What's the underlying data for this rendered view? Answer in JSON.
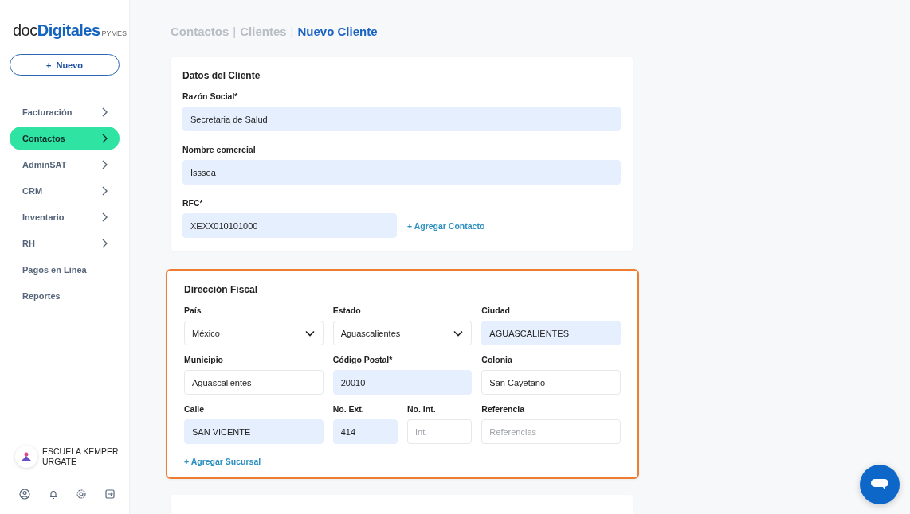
{
  "logo": {
    "prefix": "doc",
    "brand": "Digitales",
    "suffix": "PYMES"
  },
  "new_button": {
    "icon": "+",
    "label": "Nuevo"
  },
  "sidebar": {
    "items": [
      {
        "label": "Facturación",
        "selected": false,
        "has_submenu": true
      },
      {
        "label": "Contactos",
        "selected": true,
        "has_submenu": true
      },
      {
        "label": "AdminSAT",
        "selected": false,
        "has_submenu": true
      },
      {
        "label": "CRM",
        "selected": false,
        "has_submenu": true
      },
      {
        "label": "Inventario",
        "selected": false,
        "has_submenu": true
      },
      {
        "label": "RH",
        "selected": false,
        "has_submenu": true
      },
      {
        "label": "Pagos en Línea",
        "selected": false,
        "has_submenu": false
      },
      {
        "label": "Reportes",
        "selected": false,
        "has_submenu": false
      }
    ]
  },
  "account": {
    "name": "ESCUELA KEMPER URGATE"
  },
  "breadcrumb": [
    {
      "label": "Contactos",
      "current": false
    },
    {
      "label": "Clientes",
      "current": false
    },
    {
      "label": "Nuevo Cliente",
      "current": true
    }
  ],
  "breadcrumb_separator": "|",
  "client_card": {
    "title": "Datos del Cliente",
    "fields": [
      {
        "label": "Razón Social*",
        "value": "Secretaria de Salud",
        "autofilled": true
      },
      {
        "label": "Nombre comercial",
        "value": "Isssea",
        "autofilled": true
      },
      {
        "label": "RFC*",
        "value": "XEXX010101000",
        "autofilled": true
      }
    ],
    "link": "+ Agregar Contacto"
  },
  "address_card": {
    "title": "Dirección Fiscal",
    "highlighted": true,
    "fields": [
      {
        "label": "País",
        "kind": "select",
        "value": "México",
        "autofilled": false
      },
      {
        "label": "Estado",
        "kind": "select",
        "value": "Aguascalientes",
        "autofilled": false
      },
      {
        "label": "Ciudad",
        "kind": "input",
        "value": "AGUASCALIENTES",
        "autofilled": true
      },
      {
        "label": "Municipio",
        "kind": "input",
        "value": "Aguascalientes",
        "autofilled": false
      },
      {
        "label": "Código Postal*",
        "kind": "input",
        "value": "20010",
        "autofilled": true
      },
      {
        "label": "Colonia",
        "kind": "input",
        "value": "San Cayetano",
        "autofilled": false
      },
      {
        "label": "Calle",
        "kind": "input",
        "value": "SAN VICENTE",
        "autofilled": true
      },
      {
        "label": "No. Ext.",
        "kind": "input",
        "value": "414",
        "autofilled": true
      },
      {
        "label": "No. Int.",
        "kind": "input",
        "placeholder": "Int.",
        "autofilled": false
      },
      {
        "label": "Referencia",
        "kind": "input",
        "placeholder": "Referencias",
        "autofilled": false
      }
    ],
    "link": "+ Agregar Sucursal"
  }
}
